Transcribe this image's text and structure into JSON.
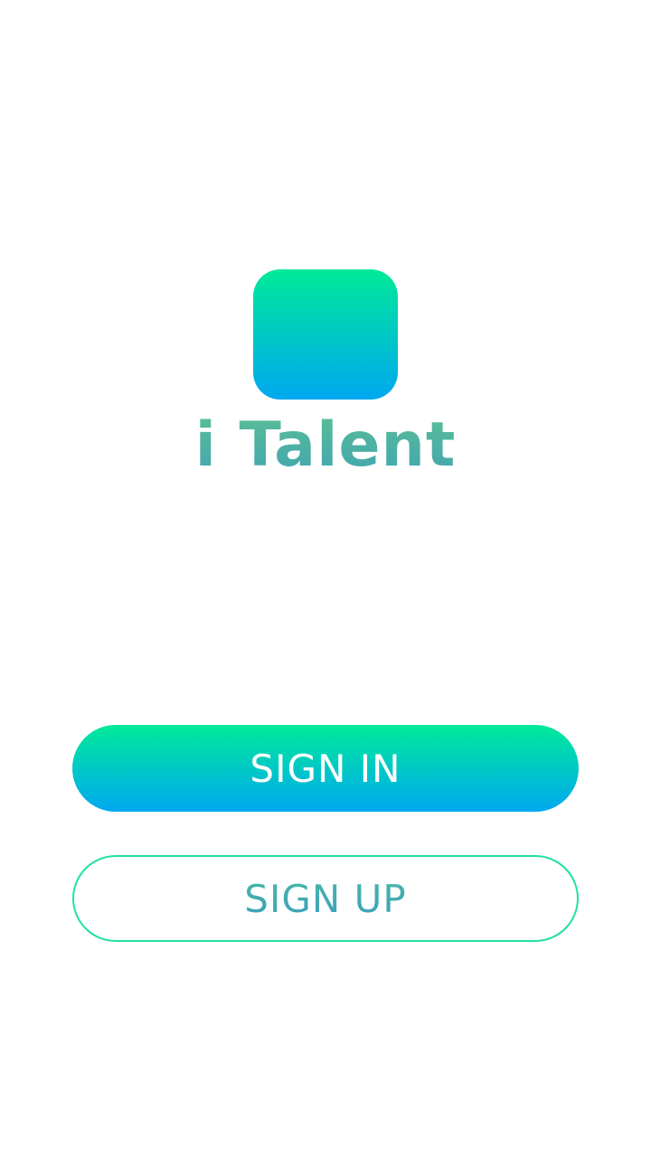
{
  "brand": {
    "name": "i Talent",
    "logo_icon": "app-logo-icon",
    "gradient_top": "#00ea99",
    "gradient_bottom": "#00a8f0",
    "text_color": "#4fb0a0"
  },
  "actions": {
    "sign_in_label": "SIGN IN",
    "sign_up_label": "SIGN UP",
    "sign_up_border_color": "#1fe29c"
  }
}
